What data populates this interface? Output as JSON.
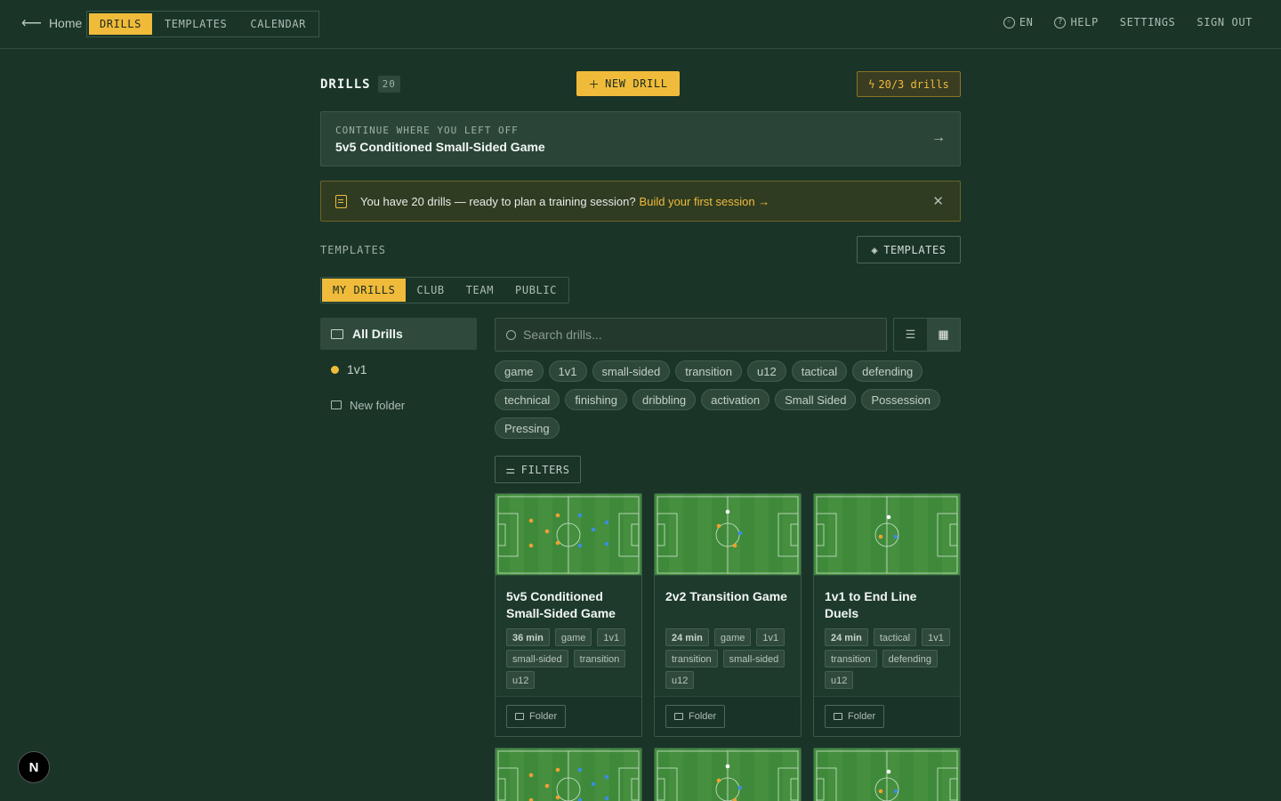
{
  "nav": {
    "home": "Home",
    "tabs": [
      "DRILLS",
      "TEMPLATES",
      "CALENDAR"
    ],
    "active_tab": "DRILLS",
    "right": {
      "lang": "EN",
      "help": "HELP",
      "settings": "SETTINGS",
      "signout": "SIGN OUT"
    }
  },
  "header": {
    "title": "DRILLS",
    "count": "20",
    "new_drill": "NEW DRILL",
    "quota": "20/3 drills"
  },
  "continue": {
    "label": "CONTINUE WHERE YOU LEFT OFF",
    "title": "5v5 Conditioned Small-Sided Game"
  },
  "banner": {
    "text": "You have 20 drills — ready to plan a training session?",
    "link": "Build your first session →"
  },
  "templates": {
    "label": "TEMPLATES",
    "button": "TEMPLATES"
  },
  "scope_tabs": [
    "MY DRILLS",
    "CLUB",
    "TEAM",
    "PUBLIC"
  ],
  "sidebar": {
    "all": "All Drills",
    "folder": "1v1",
    "new_folder": "New folder"
  },
  "search": {
    "placeholder": "Search drills..."
  },
  "tags": [
    "game",
    "1v1",
    "small-sided",
    "transition",
    "u12",
    "tactical",
    "defending",
    "technical",
    "finishing",
    "dribbling",
    "activation",
    "Small Sided",
    "Possession",
    "Pressing"
  ],
  "filters": "FILTERS",
  "cards": [
    {
      "title": "5v5 Conditioned Small-Sided Game",
      "chips": [
        "36 min",
        "game",
        "1v1",
        "small-sided",
        "transition",
        "u12"
      ],
      "folder": "Folder"
    },
    {
      "title": "2v2 Transition Game",
      "chips": [
        "24 min",
        "game",
        "1v1",
        "transition",
        "small-sided",
        "u12"
      ],
      "folder": "Folder"
    },
    {
      "title": "1v1 to End Line Duels",
      "chips": [
        "24 min",
        "tactical",
        "1v1",
        "transition",
        "defending",
        "u12"
      ],
      "folder": "Folder"
    }
  ],
  "colors": {
    "accent": "#f0bb3a",
    "background": "#1a3428"
  }
}
